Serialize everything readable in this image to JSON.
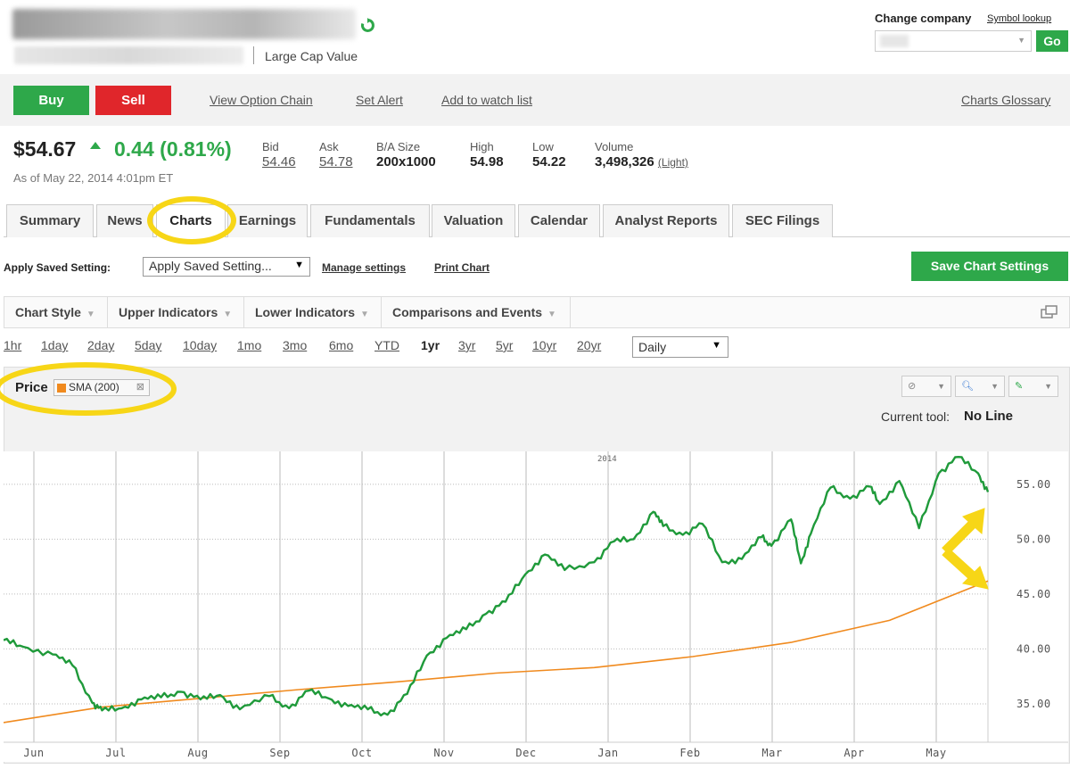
{
  "header": {
    "cap_label": "Large Cap Value",
    "change_company_label": "Change company",
    "symbol_lookup": "Symbol lookup",
    "go_label": "Go"
  },
  "actions": {
    "buy": "Buy",
    "sell": "Sell",
    "view_option_chain": "View Option Chain",
    "set_alert": "Set Alert",
    "add_watch": "Add to watch list",
    "charts_glossary": "Charts Glossary"
  },
  "quote": {
    "price": "$54.67",
    "change": "0.44 (0.81%)",
    "as_of": "As of May 22, 2014 4:01pm ET",
    "bid_label": "Bid",
    "bid": "54.46",
    "ask_label": "Ask",
    "ask": "54.78",
    "ba_label": "B/A Size",
    "ba": "200x1000",
    "high_label": "High",
    "high": "54.98",
    "low_label": "Low",
    "low": "54.22",
    "volume_label": "Volume",
    "volume": "3,498,326",
    "volume_link": "(Light)"
  },
  "tabs": [
    "Summary",
    "News",
    "Charts",
    "Earnings",
    "Fundamentals",
    "Valuation",
    "Calendar",
    "Analyst Reports",
    "SEC Filings"
  ],
  "active_tab": "Charts",
  "settings": {
    "apply_label": "Apply Saved Setting:",
    "apply_value": "Apply Saved Setting...",
    "manage": "Manage settings",
    "print": "Print Chart",
    "save": "Save Chart Settings"
  },
  "indicators": [
    "Chart Style",
    "Upper Indicators",
    "Lower Indicators",
    "Comparisons and Events"
  ],
  "ranges": [
    "1hr",
    "1day",
    "2day",
    "5day",
    "10day",
    "1mo",
    "3mo",
    "6mo",
    "YTD",
    "1yr",
    "3yr",
    "5yr",
    "10yr",
    "20yr"
  ],
  "active_range": "1yr",
  "interval": "Daily",
  "panel": {
    "price_label": "Price",
    "sma_label": "SMA (200)",
    "current_tool_label": "Current tool:",
    "current_tool_value": "No Line"
  },
  "colors": {
    "green": "#2ea84a",
    "red": "#e0262b",
    "price_line": "#1f9a3a",
    "sma_line": "#f08a1e",
    "annotation": "#f7d617"
  },
  "chart_data": {
    "type": "line",
    "year_marker": "2014",
    "x_labels": [
      "Jun",
      "Jul",
      "Aug",
      "Sep",
      "Oct",
      "Nov",
      "Dec",
      "Jan",
      "Feb",
      "Mar",
      "Apr",
      "May"
    ],
    "y_ticks": [
      "35.00",
      "40.00",
      "45.00",
      "50.00",
      "55.00"
    ],
    "ylim": [
      31.5,
      58
    ],
    "grid": true,
    "series": [
      {
        "name": "Price",
        "x": [
          0,
          0.02,
          0.05,
          0.07,
          0.09,
          0.1,
          0.12,
          0.14,
          0.16,
          0.18,
          0.2,
          0.22,
          0.24,
          0.27,
          0.29,
          0.31,
          0.33,
          0.35,
          0.37,
          0.39,
          0.41,
          0.43,
          0.45,
          0.47,
          0.49,
          0.51,
          0.53,
          0.55,
          0.57,
          0.6,
          0.62,
          0.64,
          0.66,
          0.67,
          0.69,
          0.71,
          0.73,
          0.75,
          0.77,
          0.78,
          0.8,
          0.81,
          0.82,
          0.84,
          0.86,
          0.88,
          0.89,
          0.91,
          0.93,
          0.95,
          0.97,
          0.99,
          1.0
        ],
        "values": [
          40.8,
          40.2,
          39.5,
          38.5,
          35.1,
          34.4,
          34.6,
          35.4,
          35.6,
          36.1,
          35.4,
          35.8,
          34.5,
          35.7,
          34.6,
          36.2,
          35.5,
          34.8,
          34.5,
          34.0,
          35.9,
          39.4,
          41.0,
          41.8,
          43.2,
          44.3,
          46.8,
          48.6,
          47.2,
          47.9,
          49.8,
          50.0,
          52.5,
          51.2,
          50.4,
          51.4,
          47.9,
          48.2,
          50.2,
          49.4,
          51.8,
          47.8,
          50.5,
          54.7,
          53.7,
          54.8,
          53.2,
          55.3,
          51.0,
          56.0,
          57.5,
          56.0,
          54.3
        ]
      },
      {
        "name": "SMA (200)",
        "x": [
          0,
          0.1,
          0.2,
          0.3,
          0.4,
          0.5,
          0.6,
          0.7,
          0.8,
          0.9,
          1.0
        ],
        "values": [
          33.3,
          34.7,
          35.5,
          36.3,
          37.0,
          37.8,
          38.3,
          39.3,
          40.6,
          42.6,
          46.2
        ]
      }
    ]
  }
}
